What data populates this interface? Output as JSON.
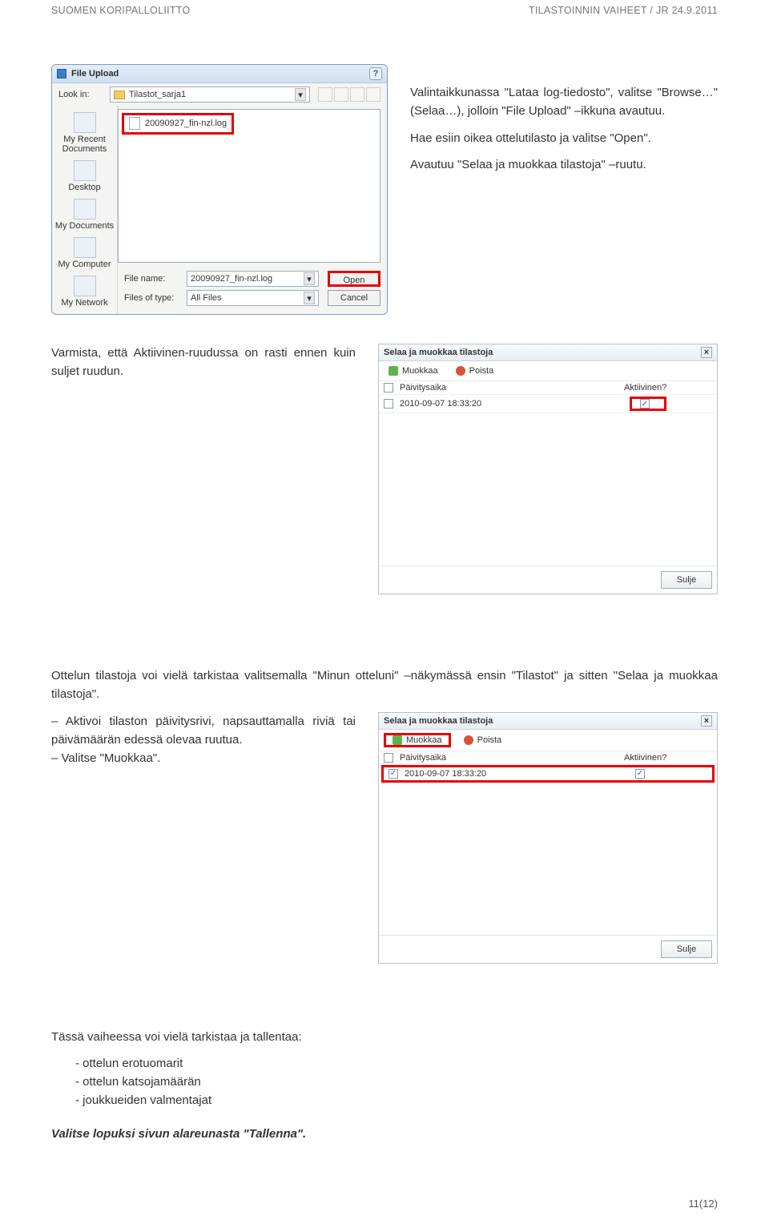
{
  "header": {
    "left": "SUOMEN KORIPALLOLIITTO",
    "right": "TILASTOINNIN VAIHEET / JR  24.9.2011"
  },
  "fileUpload": {
    "title": "File Upload",
    "lookInLabel": "Look in:",
    "lookInValue": "Tilastot_sarja1",
    "fileEntry": "20090927_fin-nzl.log",
    "sidebar": [
      "My Recent Documents",
      "Desktop",
      "My Documents",
      "My Computer",
      "My Network"
    ],
    "fileNameLabel": "File name:",
    "fileNameValue": "20090927_fin-nzl.log",
    "fileTypeLabel": "Files of type:",
    "fileTypeValue": "All Files",
    "openBtn": "Open",
    "cancelBtn": "Cancel"
  },
  "para1": "Valintaikkunassa \"Lataa log-tiedosto\", valitse \"Browse…\" (Selaa…), jolloin \"File Upload\" –ikkuna avautuu.",
  "para2": "Hae esiin oikea ottelutilasto ja valitse \"Open\".",
  "para3": "Avautuu \"Selaa ja muokkaa tilastoja\" –ruutu.",
  "para4": "Varmista, että Aktiivinen-ruudussa on rasti ennen kuin suljet ruudun.",
  "sm1": {
    "title": "Selaa ja muokkaa tilastoja",
    "muokkaa": "Muokkaa",
    "poista": "Poista",
    "colDate": "Päivitysaika",
    "colActive": "Aktiivinen?",
    "rowDate": "2010-09-07 18:33:20",
    "sulje": "Sulje",
    "activeChecked": true,
    "rowChecked": false,
    "highlightRow": false,
    "highlightActiveCell": true
  },
  "para5": "Ottelun tilastoja voi vielä tarkistaa valitsemalla \"Minun otteluni\" –näkymässä ensin \"Tilastot\" ja sitten \"Selaa ja muokkaa tilastoja\".",
  "bullets1": [
    "Aktivoi tilaston päivitysrivi, napsauttamalla riviä tai päivämäärän edessä olevaa ruutua.",
    "Valitse \"Muokkaa\"."
  ],
  "sm2": {
    "title": "Selaa ja muokkaa tilastoja",
    "muokkaa": "Muokkaa",
    "poista": "Poista",
    "colDate": "Päivitysaika",
    "colActive": "Aktiivinen?",
    "rowDate": "2010-09-07 18:33:20",
    "sulje": "Sulje",
    "activeChecked": true,
    "rowChecked": true,
    "highlightRow": true,
    "highlightActiveCell": false
  },
  "para6": "Tässä vaiheessa voi vielä tarkistaa ja tallentaa:",
  "bullets2": [
    "ottelun erotuomarit",
    "ottelun katsojamäärän",
    "joukkueiden valmentajat"
  ],
  "para7": "Valitse lopuksi sivun alareunasta \"Tallenna\".",
  "pageNum": "11(12)"
}
